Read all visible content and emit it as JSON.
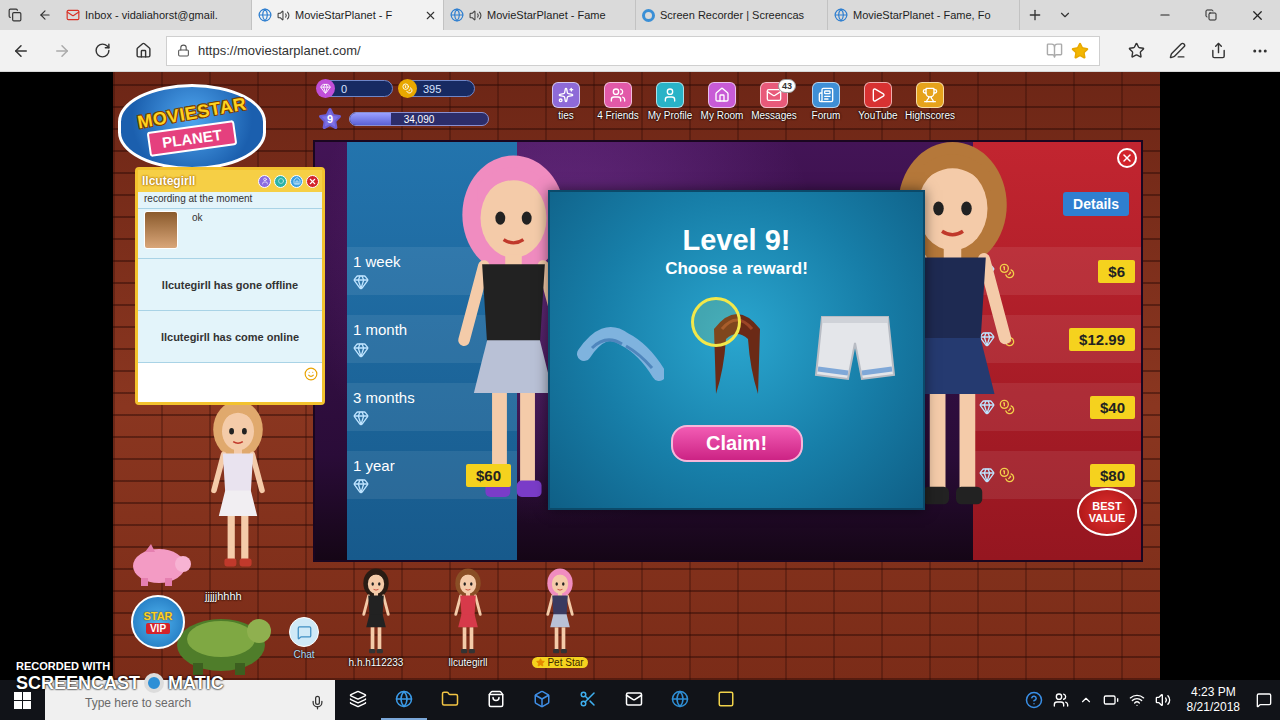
{
  "browser": {
    "tabs": [
      {
        "label": "Inbox - vidaliahorst@gmail.",
        "selected": false,
        "kind": "mail",
        "audio": false
      },
      {
        "label": "MovieStarPlanet - F",
        "selected": true,
        "kind": "edge",
        "audio": true
      },
      {
        "label": "MovieStarPlanet - Fame",
        "selected": false,
        "kind": "edge",
        "audio": true
      },
      {
        "label": "Screen Recorder | Screencas",
        "selected": false,
        "kind": "recorder",
        "audio": false
      },
      {
        "label": "MovieStarPlanet - Fame, Fo",
        "selected": false,
        "kind": "edge",
        "audio": false
      }
    ],
    "address": {
      "url": "https://moviestarplanet.com/",
      "favorited": true
    }
  },
  "game": {
    "logo": [
      "MOVIESTAR",
      "PLANET"
    ],
    "hud": {
      "diamonds": "0",
      "coins": "395",
      "level": "9",
      "xp": "34,090",
      "xp_level": 0.3
    },
    "nav": [
      {
        "label": "ties"
      },
      {
        "label": "4 Friends"
      },
      {
        "label": "My Profile"
      },
      {
        "label": "My Room"
      },
      {
        "label": "Messages",
        "badge": "43"
      },
      {
        "label": "Forum"
      },
      {
        "label": "YouTube"
      },
      {
        "label": "Highscores"
      }
    ],
    "chat": {
      "title": "llcutegirll",
      "messages": [
        {
          "kind": "text",
          "text": "recording at the moment"
        },
        {
          "kind": "avatar",
          "text": "ok"
        },
        {
          "kind": "status",
          "text": "llcutegirll has gone offline"
        },
        {
          "kind": "status",
          "text": "llcutegirll has come online"
        }
      ]
    },
    "vip": {
      "left_plans": [
        {
          "label": "1 week"
        },
        {
          "label": "1 month"
        },
        {
          "label": "3 months"
        },
        {
          "label": "1 year",
          "price": "$60"
        }
      ],
      "details": "Details",
      "right_prices": [
        "$6",
        "$12.99",
        "$40",
        "$80"
      ],
      "badge": "BEST VALUE"
    },
    "modal": {
      "title": "Level 9!",
      "subtitle": "Choose a reward!",
      "rewards": [
        {
          "kind": "braid",
          "selected": false
        },
        {
          "kind": "ponytail",
          "selected": true
        },
        {
          "kind": "shorts",
          "selected": false
        }
      ],
      "button": "Claim!"
    },
    "scene": {
      "pet_name": "jjjjjhhhh",
      "vip_badge": [
        "STAR",
        "VIP"
      ],
      "chat_button": "Chat",
      "avatars": [
        {
          "name": "h.h.h112233",
          "kind": "plain"
        },
        {
          "name": "llcutegirll",
          "kind": "plain"
        },
        {
          "name": "Pet Star",
          "kind": "badge"
        }
      ]
    }
  },
  "watermark": [
    "RECORDED WITH",
    "SCREENCAST",
    "MATIC"
  ],
  "taskbar": {
    "search_placeholder": "Type here to search",
    "time": "4:23 PM",
    "date": "8/21/2018"
  }
}
